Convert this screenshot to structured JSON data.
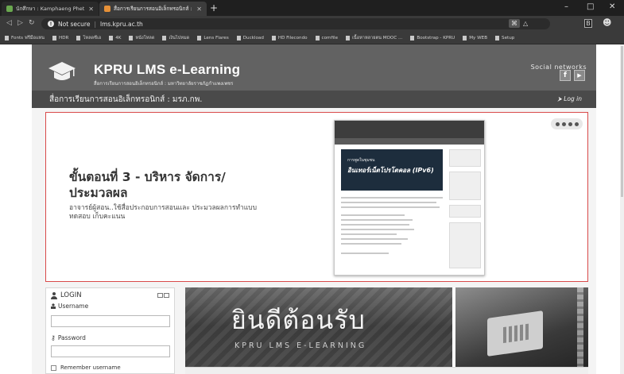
{
  "browser": {
    "tabs": [
      {
        "title": "นักศึกษา : Kamphaeng Phet Rajabh",
        "active": false
      },
      {
        "title": "สื่อการเรียนการสอนอิเล็กทรอนิกส์ : มรภ",
        "active": true
      }
    ],
    "new_tab": "+",
    "controls": {
      "minimize": "–",
      "maximize": "□",
      "close": "✕"
    },
    "nav": {
      "back": "◁",
      "forward": "▷",
      "reload": "↻"
    },
    "address": {
      "security": "Not secure",
      "url": "lms.kpru.ac.th",
      "info_glyph": "!"
    },
    "ext": {
      "translate": "⌘",
      "warn": "△",
      "gc": "B",
      "profile": "☻"
    },
    "bookmarks": [
      "Fonts ฟรีมือแหน",
      "HDR",
      "โหลดซีเอ",
      "4K",
      "หนังโหลด",
      "เงินไปหมด",
      "Lens Flares",
      "Duckload",
      "HD Filecondo",
      "comfile",
      "เนื้อหาหลายตน MOOC ...",
      "Bootstrap - KPRU",
      "My WEB",
      "Setup"
    ]
  },
  "header": {
    "title": "KPRU LMS e-Learning",
    "subtitle": "สื่อการเรียนการสอนอิเล็กทรอนิกส์ : มหาวิทยาลัยราชภัฏกำแพงเพชร",
    "social_label": "Social networks",
    "social_fb": "f",
    "social_yt": "▶"
  },
  "navbar": {
    "title": "สื่อการเรียนการสอนอิเล็กทรอนิกส์ : มรภ.กพ.",
    "login": "Log in",
    "login_icon": "⮞"
  },
  "slider": {
    "heading": "ขั้นตอนที่ 3 - บริหาร จัดการ/ประมวลผล",
    "description": "อาจารย์ผู้สอน..ใช้สื่อประกอบการสอนและ ประมวลผลการทำแบบทดสอบ เก็บคะแนน",
    "shot_label": "การพูดในชุมชน",
    "shot_title": "อินเทอร์เน็ตโปรโตคอล (IPv6)"
  },
  "login": {
    "title": "LOGIN",
    "username_label": "Username",
    "password_label": "Password",
    "remember_label": "Remember username"
  },
  "welcome": {
    "title": "ยินดีต้อนรับ",
    "subtitle": "KPRU LMS E-LEARNING"
  },
  "colors": {
    "header": "#626262",
    "navbar": "#4a4a4a",
    "slider_border": "#d94a4a"
  }
}
